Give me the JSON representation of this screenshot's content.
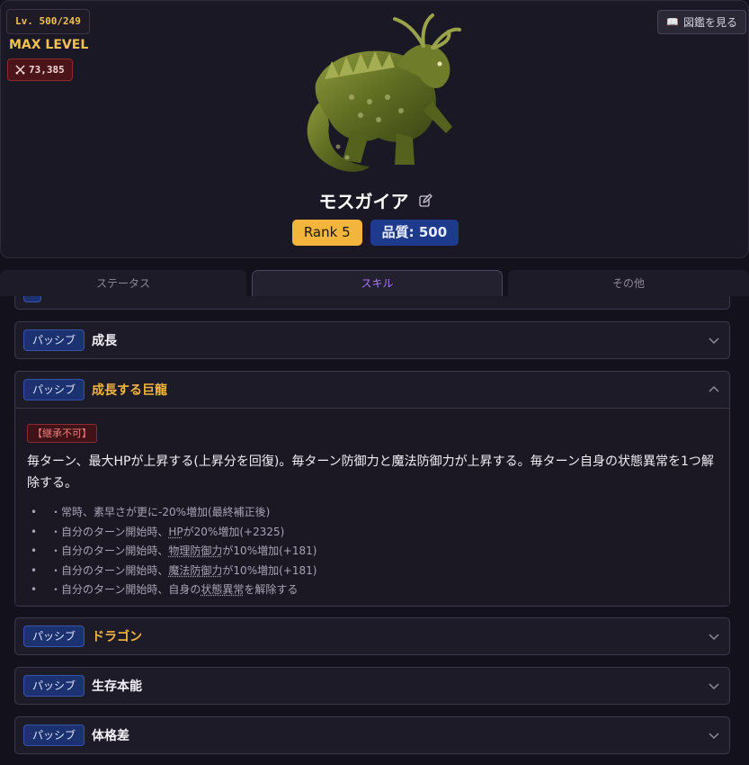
{
  "header": {
    "level": "Lv. 500/249",
    "max_level": "MAX LEVEL",
    "power": "73,385",
    "power_icon": "crossed-swords-icon",
    "book_button": "図鑑を見る",
    "book_icon": "open-book-icon",
    "monster_name": "モスガイア",
    "rank": "Rank 5",
    "quality": "品質: 500"
  },
  "tabs": [
    {
      "label": "ステータス"
    },
    {
      "label": "スキル"
    },
    {
      "label": "その他"
    }
  ],
  "skills": [
    {
      "type": "パッシブ",
      "name": "成長",
      "expanded": false
    },
    {
      "type": "パッシブ",
      "name": "成長する巨龍",
      "expanded": true,
      "badge": "【継承不可】",
      "description": "毎ターン、最大HPが上昇する(上昇分を回復)。毎ターン防御力と魔法防御力が上昇する。毎ターン自身の状態異常を1つ解除する。",
      "effects": [
        {
          "pre": "・常時、素早さが更に-20%増加(最終補正後)",
          "term": "",
          "post": ""
        },
        {
          "pre": "・自分のターン開始時、",
          "term": "HP",
          "post": "が20%増加(+2325)"
        },
        {
          "pre": "・自分のターン開始時、",
          "term": "物理防御力",
          "post": "が10%増加(+181)"
        },
        {
          "pre": "・自分のターン開始時、",
          "term": "魔法防御力",
          "post": "が10%増加(+181)"
        },
        {
          "pre": "・自分のターン開始時、自身の",
          "term": "状態異常",
          "post": "を解除する"
        }
      ]
    },
    {
      "type": "パッシブ",
      "name": "ドラゴン",
      "expanded": false
    },
    {
      "type": "パッシブ",
      "name": "生存本能",
      "expanded": false
    },
    {
      "type": "パッシブ",
      "name": "体格差",
      "expanded": false
    }
  ],
  "colors": {
    "background": "#13111c",
    "card": "#1e1b28",
    "gold": "#f3b53c",
    "accent_purple": "#a776ff",
    "passive_tag": "#1c3170",
    "danger": "#8b2a31"
  }
}
